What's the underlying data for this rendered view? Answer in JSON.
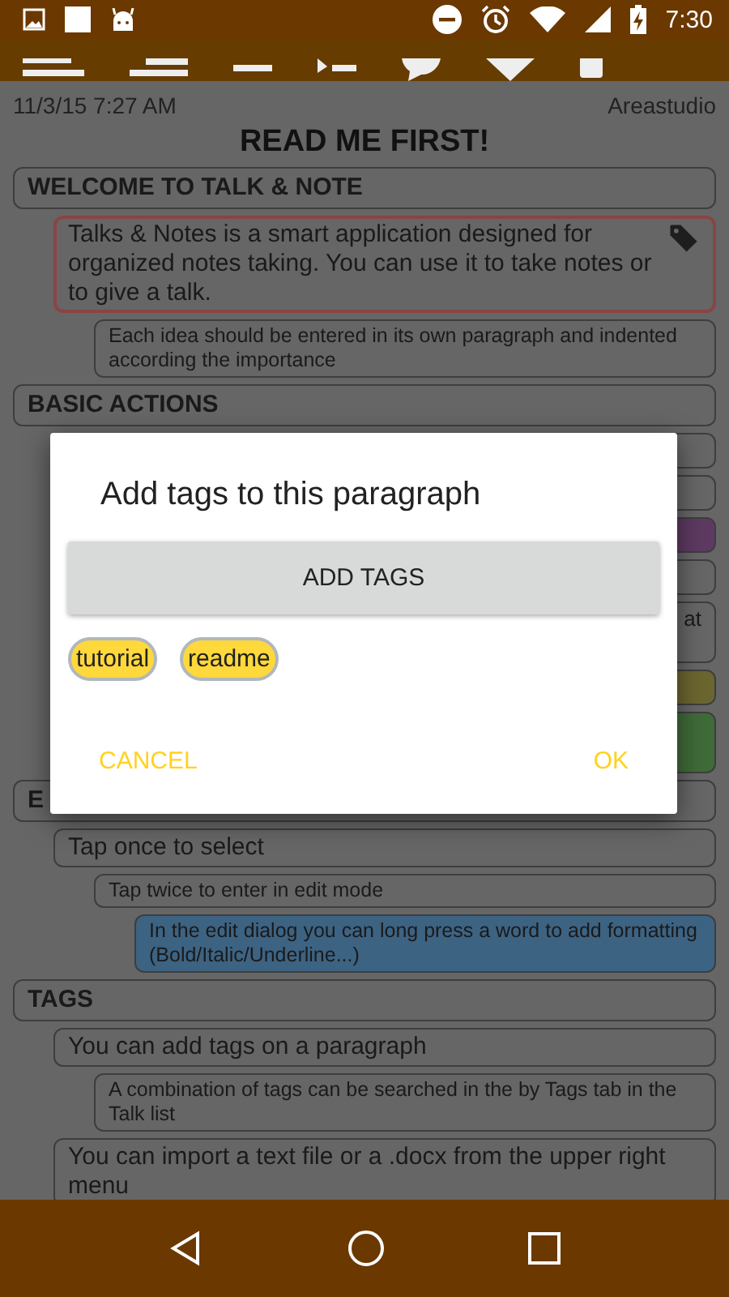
{
  "status_bar": {
    "time": "7:30"
  },
  "note": {
    "date": "11/3/15 7:27 AM",
    "author": "Areastudio",
    "title": "READ ME FIRST!"
  },
  "outline": [
    {
      "text": "WELCOME TO TALK & NOTE",
      "children": [
        {
          "text": "Talks & Notes is a smart application designed for organized notes taking. You can use it to take notes or to give a talk.",
          "selected": true,
          "tagged": true,
          "children": [
            {
              "text": "Each idea should be entered in its own paragraph and indented according the importance",
              "selected": false,
              "tagged": false
            }
          ]
        }
      ]
    },
    {
      "text": "BASIC ACTIONS",
      "children": [
        {
          "kind": "line",
          "selected": false
        },
        {
          "kind": "line",
          "selected": false
        },
        {
          "kind": "line",
          "selected": false,
          "color": "#5e3a62"
        },
        {
          "kind": "line",
          "selected": false
        },
        {
          "kind": "cut",
          "text": "at",
          "selected": false
        },
        {
          "kind": "line",
          "selected": false,
          "color": "#6b6630"
        },
        {
          "kind": "cut",
          "selected": false,
          "color": "#3f6b38"
        }
      ]
    },
    {
      "text": "E",
      "children": [
        {
          "text": "Tap once to select",
          "selected": false,
          "tagged": false,
          "children": [
            {
              "text": "Tap twice to enter in edit mode",
              "selected": false,
              "tagged": false,
              "children": [
                {
                  "text": "In the edit dialog you can long press a word to add formatting (Bold/Italic/Underline...)",
                  "selected": false,
                  "tagged": false,
                  "color": "#3d6383"
                }
              ]
            }
          ]
        }
      ]
    },
    {
      "text": "TAGS",
      "children": [
        {
          "text": "You can add tags on a paragraph",
          "selected": false,
          "tagged": false,
          "children": [
            {
              "text": "A combination of tags can be searched in the by Tags tab in the Talk list",
              "selected": false,
              "tagged": false
            }
          ]
        },
        {
          "text": "You can import a text file or a .docx from the upper right menu",
          "selected": false,
          "tagged": false
        }
      ]
    }
  ],
  "dialog": {
    "title": "Add tags to this paragraph",
    "add_button": "ADD TAGS",
    "tags": [
      "tutorial",
      "readme"
    ],
    "buttons": [
      "CANCEL",
      "OK"
    ]
  }
}
